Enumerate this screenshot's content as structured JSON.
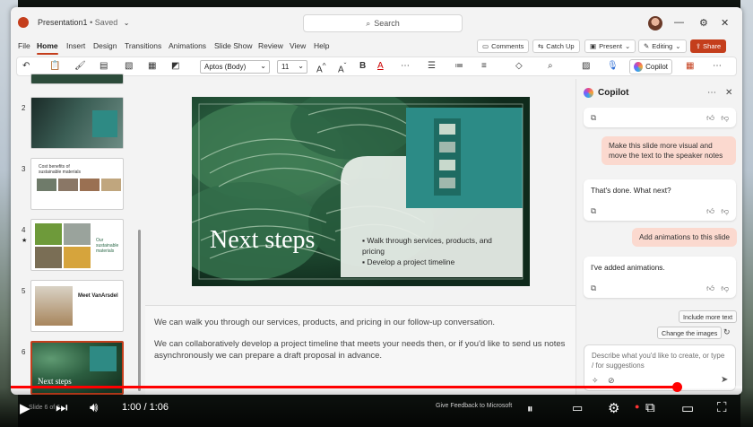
{
  "window": {
    "doc_title": "Presentation1",
    "saved_status": "• Saved",
    "search_placeholder": "Search"
  },
  "menu": [
    "File",
    "Home",
    "Insert",
    "Design",
    "Transitions",
    "Animations",
    "Slide Show",
    "Review",
    "View",
    "Help"
  ],
  "right_buttons": {
    "comments": "Comments",
    "catch_up": "Catch Up",
    "present": "Present",
    "editing": "Editing",
    "share": "Share"
  },
  "toolbar": {
    "font_name": "Aptos (Body)",
    "font_size": "11",
    "copilot_label": "Copilot"
  },
  "thumbnails": [
    {
      "num": "2"
    },
    {
      "num": "3",
      "title": "Cost benefits of sustainable materials"
    },
    {
      "num": "4",
      "title": "Our sustainable materials"
    },
    {
      "num": "5",
      "title": "Meet VanArsdel"
    },
    {
      "num": "6",
      "title": "Next steps"
    }
  ],
  "slide": {
    "title": "Next steps",
    "bullets": [
      "Walk through services, products, and pricing",
      "Develop a project timeline"
    ]
  },
  "notes": [
    "We can walk you through our services, products, and pricing in our follow-up conversation.",
    "We can collaboratively develop a project timeline that meets your needs then, or if you'd like to send us notes asynchronously we can prepare a draft proposal in advance."
  ],
  "copilot": {
    "title": "Copilot",
    "messages": [
      {
        "role": "user",
        "text": "Make this slide more visual and move the text to the speaker notes"
      },
      {
        "role": "assistant",
        "text": "That's done. What next?"
      },
      {
        "role": "user",
        "text": "Add animations to this slide"
      },
      {
        "role": "assistant",
        "text": "I've added animations."
      }
    ],
    "suggestions": [
      "Include more text",
      "Change the images"
    ],
    "compose_placeholder": "Describe what you'd like to create, or type / for suggestions"
  },
  "video": {
    "time": "1:00 / 1:06",
    "progress": 0.91,
    "bottom_text_left": "Give Feedback to Microsoft",
    "bottom_text_slide": "Slide 6 of 6"
  },
  "colors": {
    "accent": "#c43e1c",
    "user_bubble": "#fbd9cf",
    "progress": "#ff0000"
  }
}
